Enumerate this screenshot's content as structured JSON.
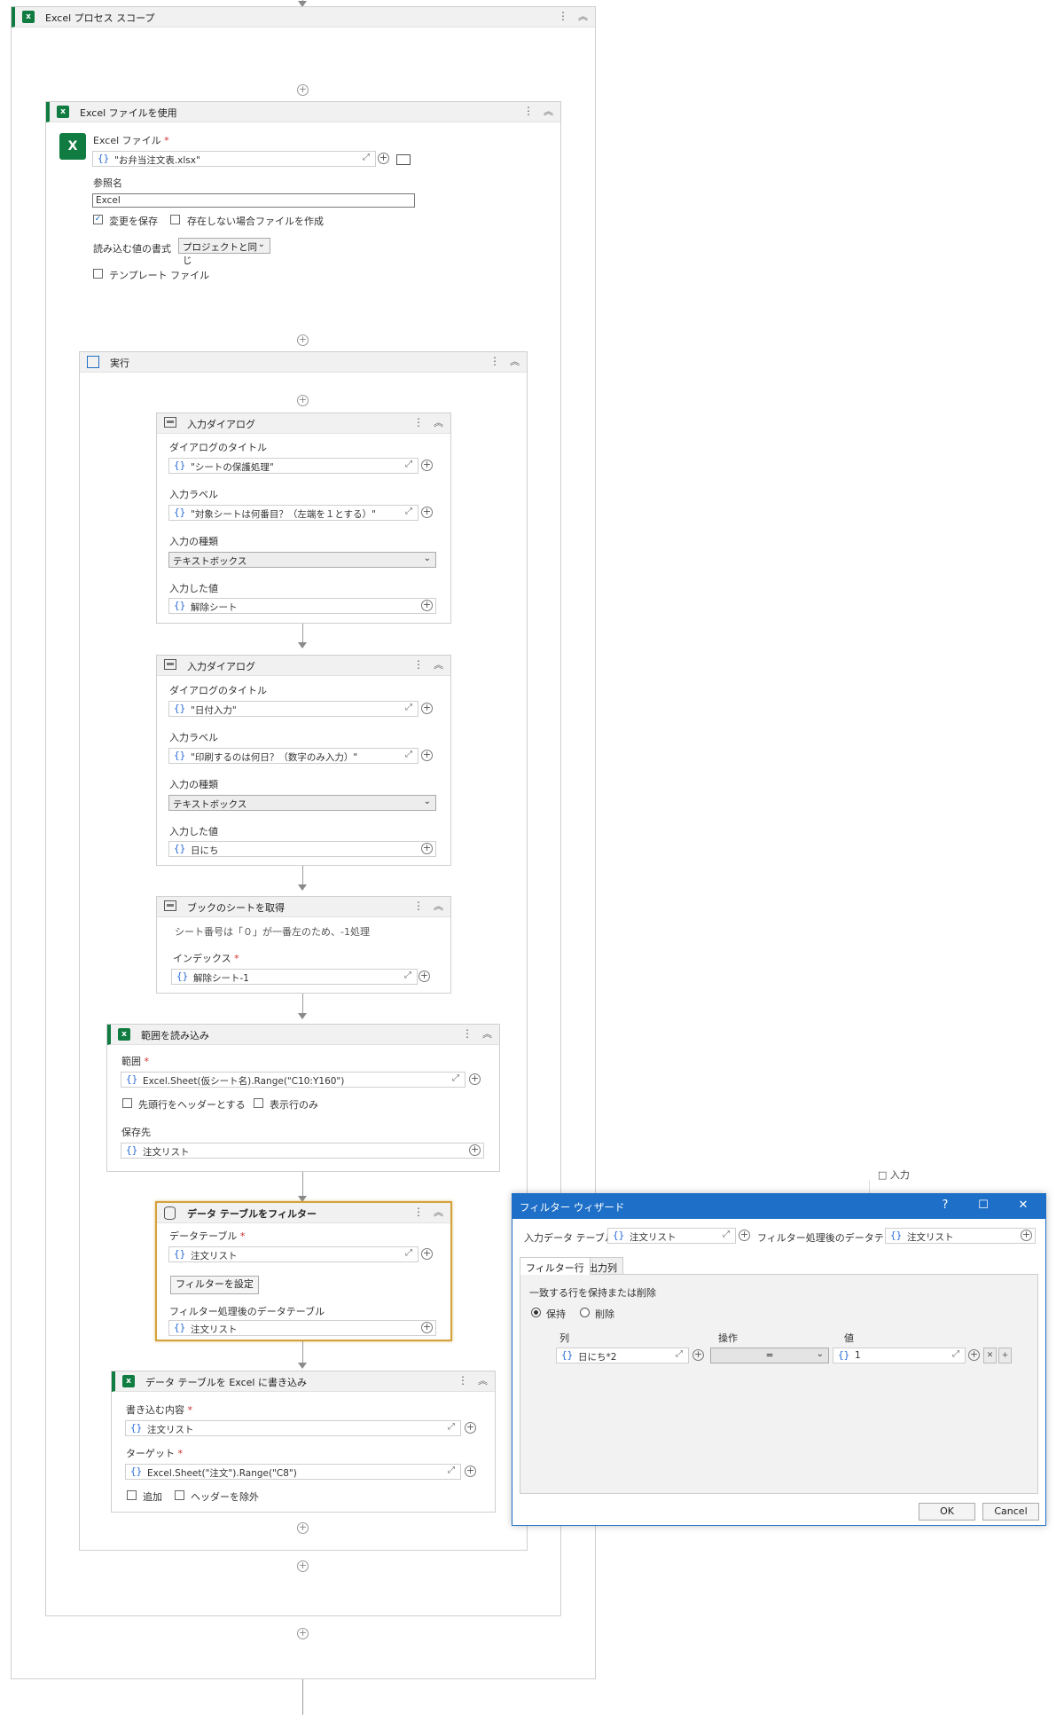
{
  "scope": {
    "title": "Excel プロセス スコープ"
  },
  "use_file": {
    "title": "Excel ファイルを使用",
    "file_label": "Excel ファイル",
    "file_value": "\"お弁当注文表.xlsx\"",
    "ref_label": "参照名",
    "ref_value": "Excel",
    "save_changes": "変更を保存",
    "create_if_missing": "存在しない場合ファイルを作成",
    "read_format_label": "読み込む値の書式",
    "read_format_value": "プロジェクトと同じ",
    "template_file": "テンプレート ファイル"
  },
  "exec": {
    "title": "実行"
  },
  "input_dialog_1": {
    "title": "入力ダイアログ",
    "dlg_title_label": "ダイアログのタイトル",
    "dlg_title_value": "\"シートの保護処理\"",
    "input_label_label": "入力ラベル",
    "input_label_value": "\"対象シートは何番目？（左端を１とする）\"",
    "input_type_label": "入力の種類",
    "input_type_value": "テキストボックス",
    "entered_label": "入力した値",
    "entered_value": "解除シート"
  },
  "input_dialog_2": {
    "title": "入力ダイアログ",
    "dlg_title_label": "ダイアログのタイトル",
    "dlg_title_value": "\"日付入力\"",
    "input_label_label": "入力ラベル",
    "input_label_value": "\"印刷するのは何日？（数字のみ入力）\"",
    "input_type_label": "入力の種類",
    "input_type_value": "テキストボックス",
    "entered_label": "入力した値",
    "entered_value": "日にち"
  },
  "get_sheet": {
    "title": "ブックのシートを取得",
    "note": "シート番号は「０」が一番左のため、-1処理",
    "index_label": "インデックス",
    "index_value": "解除シート-1"
  },
  "read_range": {
    "title": "範囲を読み込み",
    "range_label": "範囲",
    "range_value": "Excel.Sheet(仮シート名).Range(\"C10:Y160\")",
    "header_opt": "先頭行をヘッダーとする",
    "visible_opt": "表示行のみ",
    "save_to_label": "保存先",
    "save_to_value": "注文リスト"
  },
  "filter_dt": {
    "title": "データ テーブルをフィルター",
    "dt_label": "データテーブル",
    "dt_value": "注文リスト",
    "set_filter_btn": "フィルターを設定",
    "out_label": "フィルター処理後のデータテーブル",
    "out_value": "注文リスト"
  },
  "write_dt": {
    "title": "データ テーブルを Excel に書き込み",
    "content_label": "書き込む内容",
    "content_value": "注文リスト",
    "target_label": "ターゲット",
    "target_value": "Excel.Sheet(\"注文\").Range(\"C8\")",
    "append_opt": "追加",
    "exclude_header_opt": "ヘッダーを除外"
  },
  "wizard": {
    "title": "フィルター ウィザード",
    "help": "?",
    "maximize": "☐",
    "close": "✕",
    "input_dt_label": "入力データ テーブル",
    "input_dt_value": "注文リスト",
    "output_dt_label": "フィルター処理後のデータテ:",
    "output_dt_value": "注文リスト",
    "tab_filter_rows": "フィルター行",
    "tab_output_cols": "出力列",
    "match_rows_label": "一致する行を保持または削除",
    "keep": "保持",
    "remove": "削除",
    "col_header": "列",
    "op_header": "操作",
    "value_header": "値",
    "row_col_value": "日にち*2",
    "row_op_value": "=",
    "row_value": "1",
    "ok": "OK",
    "cancel": "Cancel"
  },
  "side_fragment": "□ 入力"
}
